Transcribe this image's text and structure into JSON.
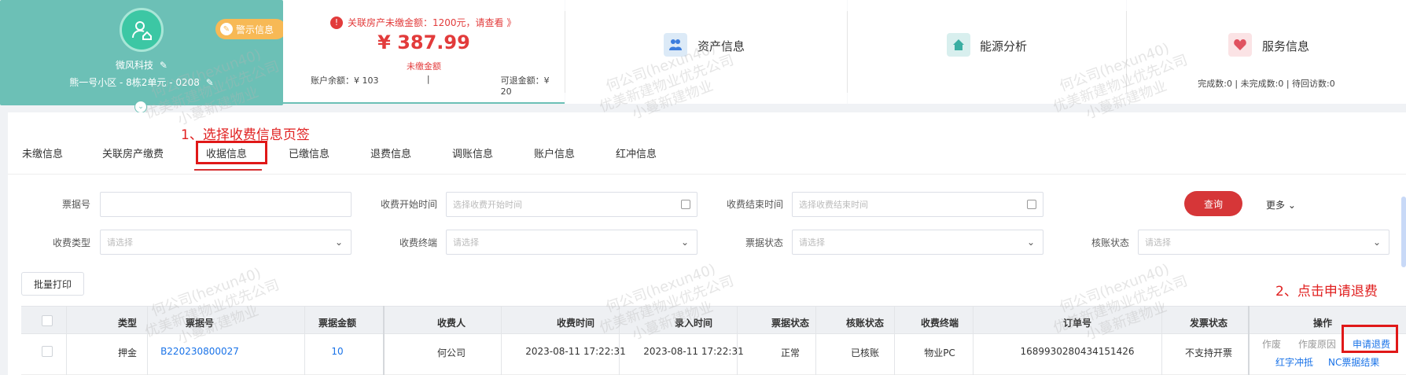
{
  "profile": {
    "warning_badge": "警示信息",
    "company": "微风科技",
    "address": "熊一号小区 - 8栋2单元 - 0208"
  },
  "arrears": {
    "alert": "关联房产未缴金额：1200元，请查看 》",
    "amount": "¥ 387.99",
    "amount_label": "未缴金额",
    "balance": "账户余额：¥ 103",
    "separator": "|",
    "refundable": "可退金额：¥ 20"
  },
  "cards": {
    "assets": "资产信息",
    "energy": "能源分析",
    "service": "服务信息",
    "service_stats": "完成数:0 | 未完成数:0 | 待回访数:0"
  },
  "tabs": [
    "未缴信息",
    "关联房产缴费",
    "收据信息",
    "已缴信息",
    "退费信息",
    "调账信息",
    "账户信息",
    "红冲信息"
  ],
  "active_tab_index": 2,
  "annotations": {
    "step1": "1、选择收费信息页签",
    "step2": "2、点击申请退费"
  },
  "filters": {
    "receipt_no_label": "票据号",
    "receipt_no_value": "",
    "start_label": "收费开始时间",
    "start_placeholder": "选择收费开始时间",
    "end_label": "收费结束时间",
    "end_placeholder": "选择收费结束时间",
    "type_label": "收费类型",
    "type_placeholder": "请选择",
    "terminal_label": "收费终端",
    "terminal_placeholder": "请选择",
    "status_label": "票据状态",
    "status_placeholder": "请选择",
    "audit_label": "核账状态",
    "audit_placeholder": "请选择",
    "query_button": "查询",
    "more_button": "更多"
  },
  "batch_print": "批量打印",
  "table": {
    "headers": [
      "类型",
      "票据号",
      "票据金额",
      "收费人",
      "收费时间",
      "录入时间",
      "票据状态",
      "核账状态",
      "收费终端",
      "订单号",
      "发票状态",
      "操作"
    ],
    "rows": [
      {
        "type": "押金",
        "receipt_no": "B220230800027",
        "amount": "10",
        "collector": "何公司",
        "charge_time": "2023-08-11 17:22:31",
        "entry_time": "2023-08-11 17:22:31",
        "receipt_status": "正常",
        "audit_status": "已核账",
        "terminal": "物业PC",
        "order_no": "1689930280434151426",
        "invoice_status": "不支持开票",
        "actions": {
          "void": "作废",
          "void_reason": "作废原因",
          "apply_refund": "申请退费",
          "red_offset": "红字冲抵",
          "nc_result": "NC票据结果"
        }
      }
    ]
  },
  "watermark": {
    "line1": "何公司(hexun40)",
    "line2": "优美新建物业优先公司",
    "line3": "小蔓新建物业"
  },
  "colors": {
    "teal": "#6cc0b6",
    "danger": "#d63638",
    "link": "#1a73e8"
  }
}
